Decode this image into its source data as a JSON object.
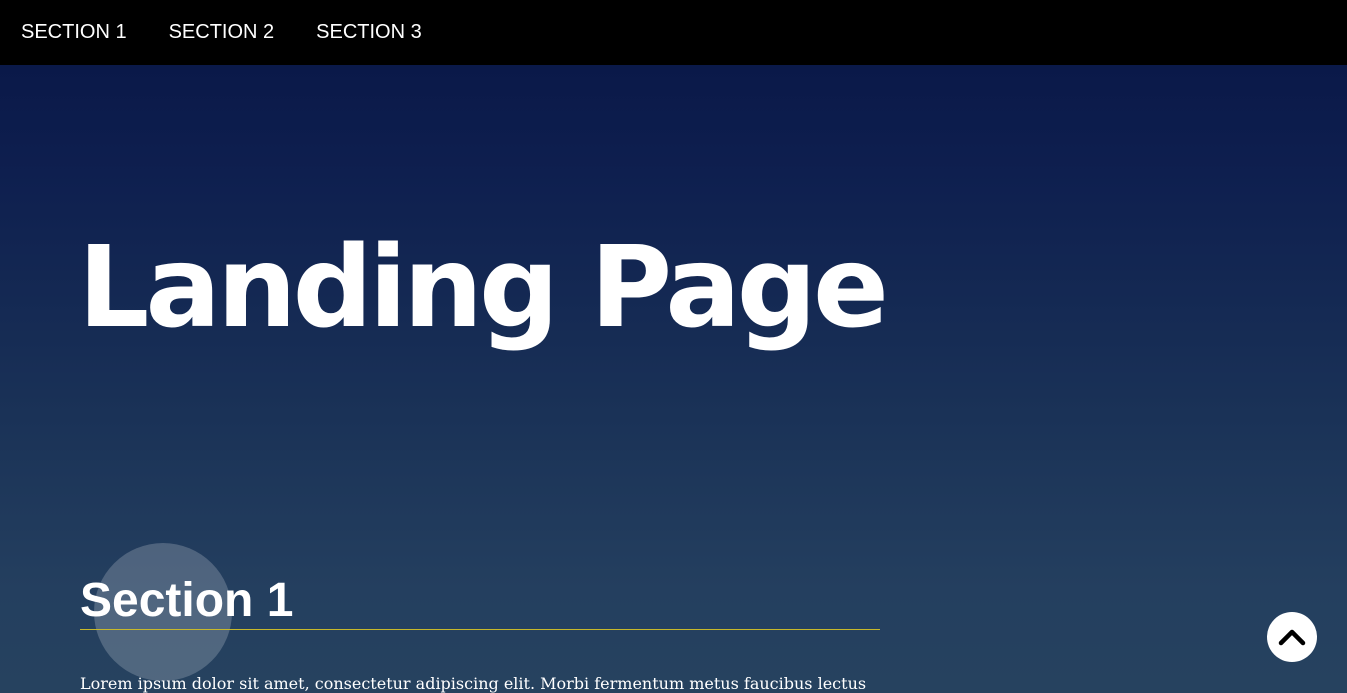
{
  "nav": {
    "items": [
      {
        "label": "SECTION 1"
      },
      {
        "label": "SECTION 2"
      },
      {
        "label": "SECTION 3"
      }
    ]
  },
  "hero": {
    "title": "Landing Page"
  },
  "section1": {
    "heading": "Section 1",
    "text": "Lorem ipsum dolor sit amet, consectetur adipiscing elit. Morbi fermentum metus faucibus lectus"
  },
  "scroll_top_button": {
    "icon": "chevron-up-icon"
  },
  "colors": {
    "navbar": "#000000",
    "gradient_top": "#081545",
    "gradient_bottom": "#26425f",
    "heading_rule": "#c7b82a"
  }
}
